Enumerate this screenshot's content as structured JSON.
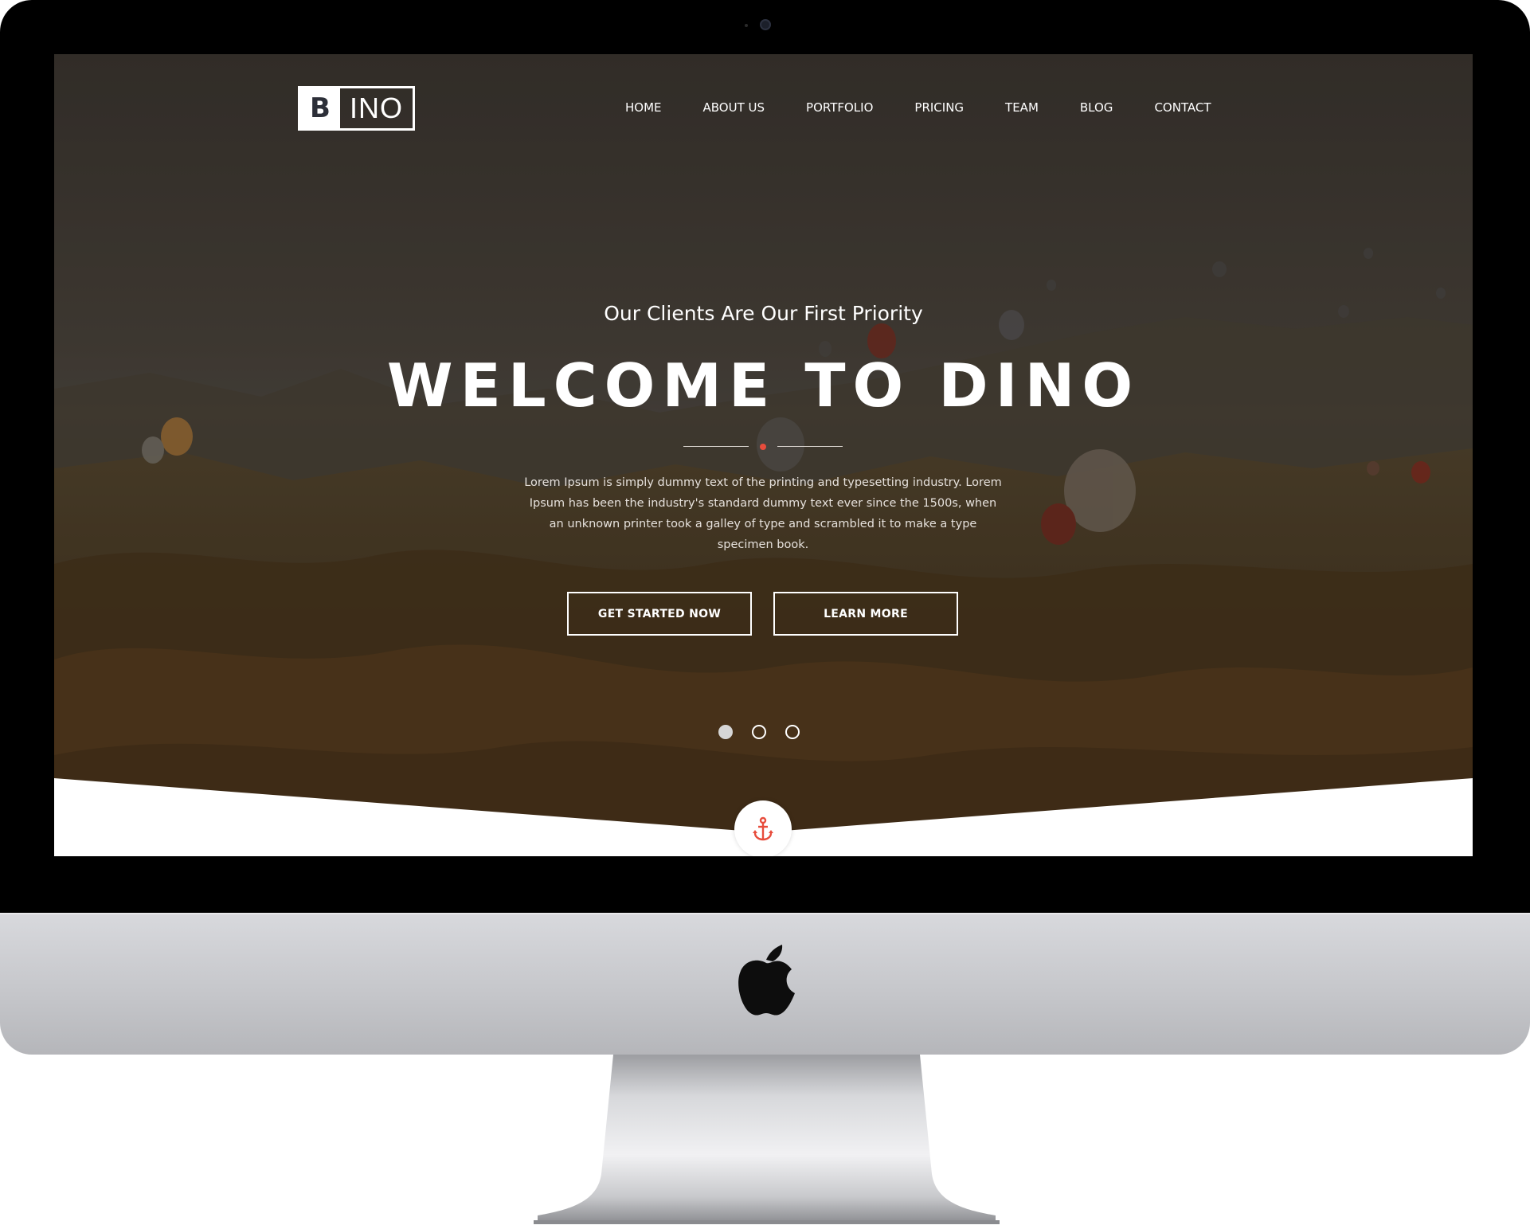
{
  "nav": {
    "logo_mark": "B",
    "logo_text": "INO",
    "items": [
      "HOME",
      "ABOUT US",
      "PORTFOLIO",
      "PRICING",
      "TEAM",
      "BLOG",
      "CONTACT"
    ]
  },
  "hero": {
    "subtitle": "Our Clients Are Our First Priority",
    "title": "WELCOME TO DINO",
    "description": "Lorem Ipsum is simply dummy text of the printing and typesetting industry. Lorem Ipsum has been the industry's standard dummy text ever since the 1500s, when an unknown printer took a galley of type and scrambled it to make a type specimen book.",
    "primary_button": "GET STARTED NOW",
    "secondary_button": "LEARN MORE",
    "slider_count": 3,
    "active_slide": 1
  },
  "scroll_icon": "anchor-icon",
  "colors": {
    "accent": "#e74c3c",
    "overlay": "#3a2f25",
    "text": "#ffffff"
  }
}
